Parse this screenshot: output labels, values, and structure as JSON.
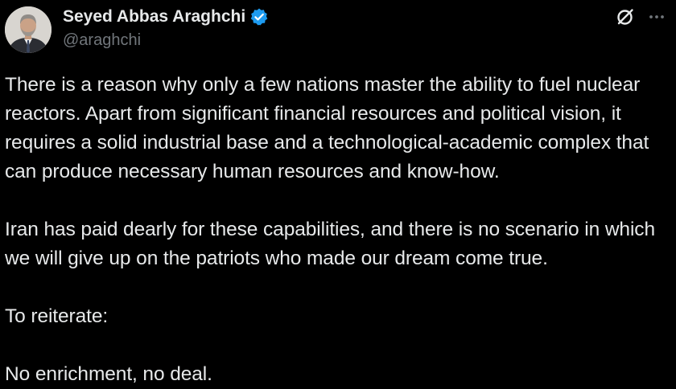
{
  "author": {
    "display_name": "Seyed Abbas Araghchi",
    "handle": "@araghchi",
    "verified": true,
    "verified_color": "#1d9bf0"
  },
  "icons": {
    "grok": "grok-icon",
    "more": "more-options-icon",
    "verified": "verified-badge-icon"
  },
  "tweet": {
    "paragraphs": [
      "There is a reason why only a few nations master the ability to fuel nuclear reactors. Apart from significant financial resources and political vision, it requires a solid industrial base and a technological-academic complex that can produce necessary human resources and know-how.",
      "Iran has paid dearly for these capabilities, and there is no scenario in which we will give up on the patriots who made our dream come true.",
      "To reiterate:",
      "No enrichment, no deal."
    ]
  },
  "colors": {
    "background": "#000000",
    "text": "#e7e9ea",
    "secondary_text": "#71767b"
  }
}
